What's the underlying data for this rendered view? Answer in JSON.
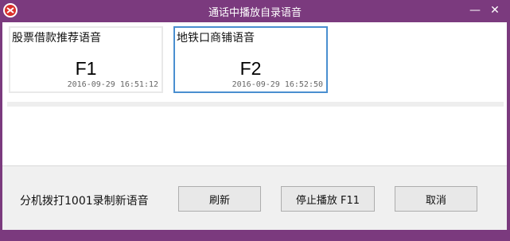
{
  "window": {
    "title": "通话中播放自录语音",
    "minimize_label": "—",
    "close_label": "✕"
  },
  "cards": [
    {
      "title": "股票借款推荐语音",
      "key": "F1",
      "timestamp": "2016-09-29 16:51:12",
      "selected": false
    },
    {
      "title": "地铁口商铺语音",
      "key": "F2",
      "timestamp": "2016-09-29 16:52:50",
      "selected": true
    }
  ],
  "footer": {
    "hint": "分机拨打1001录制新语音",
    "refresh_label": "刷新",
    "stop_label": "停止播放 F11",
    "cancel_label": "取消"
  },
  "colors": {
    "window_frame": "#7b3a7e",
    "selected_border": "#4a8fd0"
  },
  "icons": {
    "app": "red-circle-app-icon",
    "minimize": "minimize-icon",
    "close": "close-icon"
  }
}
